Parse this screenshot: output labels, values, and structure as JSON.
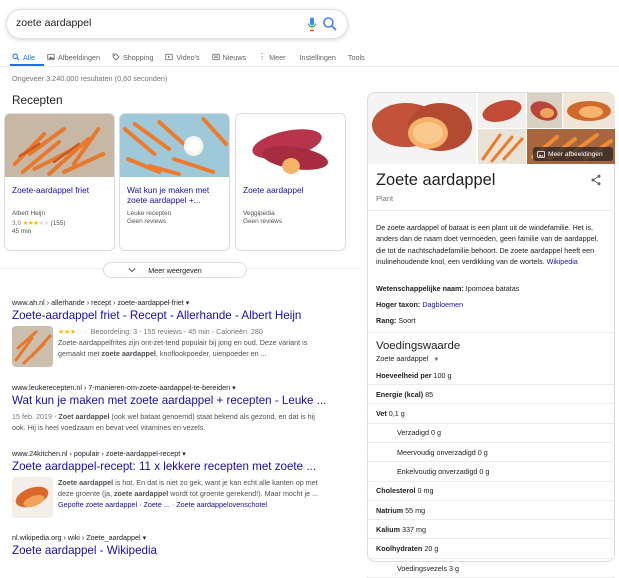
{
  "search": {
    "query": "zoete aardappel"
  },
  "tabs": [
    {
      "label": "Alle",
      "icon": "search-icon"
    },
    {
      "label": "Afbeeldingen",
      "icon": "image-icon"
    },
    {
      "label": "Shopping",
      "icon": "tag-icon"
    },
    {
      "label": "Video's",
      "icon": "video-icon"
    },
    {
      "label": "Nieuws",
      "icon": "news-icon"
    },
    {
      "label": "Meer",
      "icon": "more-icon"
    },
    {
      "label": "Instellingen",
      "icon": ""
    },
    {
      "label": "Tools",
      "icon": ""
    }
  ],
  "stats": "Ongeveer 3.240.000 resultaten (0,60 seconden)",
  "recipes": {
    "heading": "Recepten",
    "cards": [
      {
        "title": "Zoete-aardappel friet",
        "source": "Albert Heijn",
        "rating": "3,0",
        "stars": "★★★",
        "empty_stars": "★★",
        "reviews": "(155)",
        "time": "45 min"
      },
      {
        "title": "Wat kun je maken met zoete aardappel +...",
        "source": "Leuke recepten",
        "reviews_text": "Geen reviews"
      },
      {
        "title": "Zoete aardappel",
        "source": "Veggipedia",
        "reviews_text": "Geen reviews"
      }
    ],
    "more_label": "Meer weergeven"
  },
  "results": [
    {
      "cite": "www.ah.nl › allerhande › recept › zoete-aardappel-friet ▾",
      "title": "Zoete-aardappel friet - Recept - Allerhande - Albert Heijn",
      "rating_stars": "★★★",
      "rating_empty": "☆☆",
      "rating_meta": "Beoordeling: 3 - 155 reviews - 45 min - Calorieën: 280",
      "snippet_1": "Zoete-aardappelfrites zijn ont-zet-tend populair bij jong en oud. Deze variant is",
      "snippet_2a": "gemaakt met ",
      "snippet_2b": "zoete aardappel",
      "snippet_2c": ", knoflookpoeder, uienpoeder en ..."
    },
    {
      "cite": "www.leukerecepten.nl › 7-manieren-om-zoete-aardappel-te-bereiden ▾",
      "title": "Wat kun je maken met zoete aardappel + recepten - Leuke ...",
      "date": "15 feb. 2019 - ",
      "snippet_1b": "Zoet aardappel",
      "snippet_1c": " (ook wel bataat genoemd) staat bekend als gezond, en dat is hij",
      "snippet_2": "ook. Hij is heel voedzaam en bevat veel vitamines en vezels."
    },
    {
      "cite": "www.24kitchen.nl › populair › zoete-aardappel-recept ▾",
      "title": "Zoete aardappel-recept: 11 x lekkere recepten met zoete ...",
      "snippet_1a": "Zoete aardappel",
      "snippet_1b": " is hot. En dat is niet zo gek, want je kan echt alle kanten op met",
      "snippet_2a": "deze groente (ja, ",
      "snippet_2b": "zoete aardappel",
      "snippet_2c": " wordt tot groente gerekend!). Maar mocht je ...",
      "links": [
        "Gepofte zoete aardappel",
        "Zoete ...",
        "Zoete aardappelovenschotel"
      ]
    },
    {
      "cite": "nl.wikipedia.org › wiki › Zoete_aardappel ▾",
      "title": "Zoete aardappel - Wikipedia"
    }
  ],
  "knowledge_panel": {
    "more_images_label": "Meer afbeeldingen",
    "title": "Zoete aardappel",
    "subtitle": "Plant",
    "description": "De zoete aardappel of bataat is een plant uit de windefamilie. Het is, anders dan de naam doet vermoeden, geen familie van de aardappel, die tot de nachtschadefamilie behoort. De zoete aardappel heeft een inulinehoudende knol, een verdikking van de wortels.",
    "wiki_link": "Wikipedia",
    "facts": [
      {
        "label": "Wetenschappelijke naam:",
        "value": "Ipomoea batatas",
        "link": false
      },
      {
        "label": "Hoger taxon:",
        "value": "Dagbloemen",
        "link": true
      },
      {
        "label": "Rang:",
        "value": "Soort",
        "link": false
      }
    ],
    "nutrition": {
      "heading": "Voedingswaarde",
      "selector": "Zoete aardappel",
      "rows": [
        {
          "label": "Hoeveelheid per",
          "value": "100 g",
          "sub": false
        },
        {
          "label": "Energie (kcal)",
          "value": "85",
          "sub": false
        },
        {
          "label": "Vet",
          "value": "0,1 g",
          "sub": false
        },
        {
          "label": "Verzadigd",
          "value": "0 g",
          "sub": true
        },
        {
          "label": "Meervoudig onverzadigd",
          "value": "0 g",
          "sub": true
        },
        {
          "label": "Enkelvoudig onverzadigd",
          "value": "0 g",
          "sub": true
        },
        {
          "label": "Cholesterol",
          "value": "0 mg",
          "sub": false
        },
        {
          "label": "Natrium",
          "value": "55 mg",
          "sub": false
        },
        {
          "label": "Kalium",
          "value": "337 mg",
          "sub": false
        },
        {
          "label": "Koolhydraten",
          "value": "20 g",
          "sub": false
        },
        {
          "label": "Voedingsvezels",
          "value": "3 g",
          "sub": true
        }
      ]
    }
  }
}
